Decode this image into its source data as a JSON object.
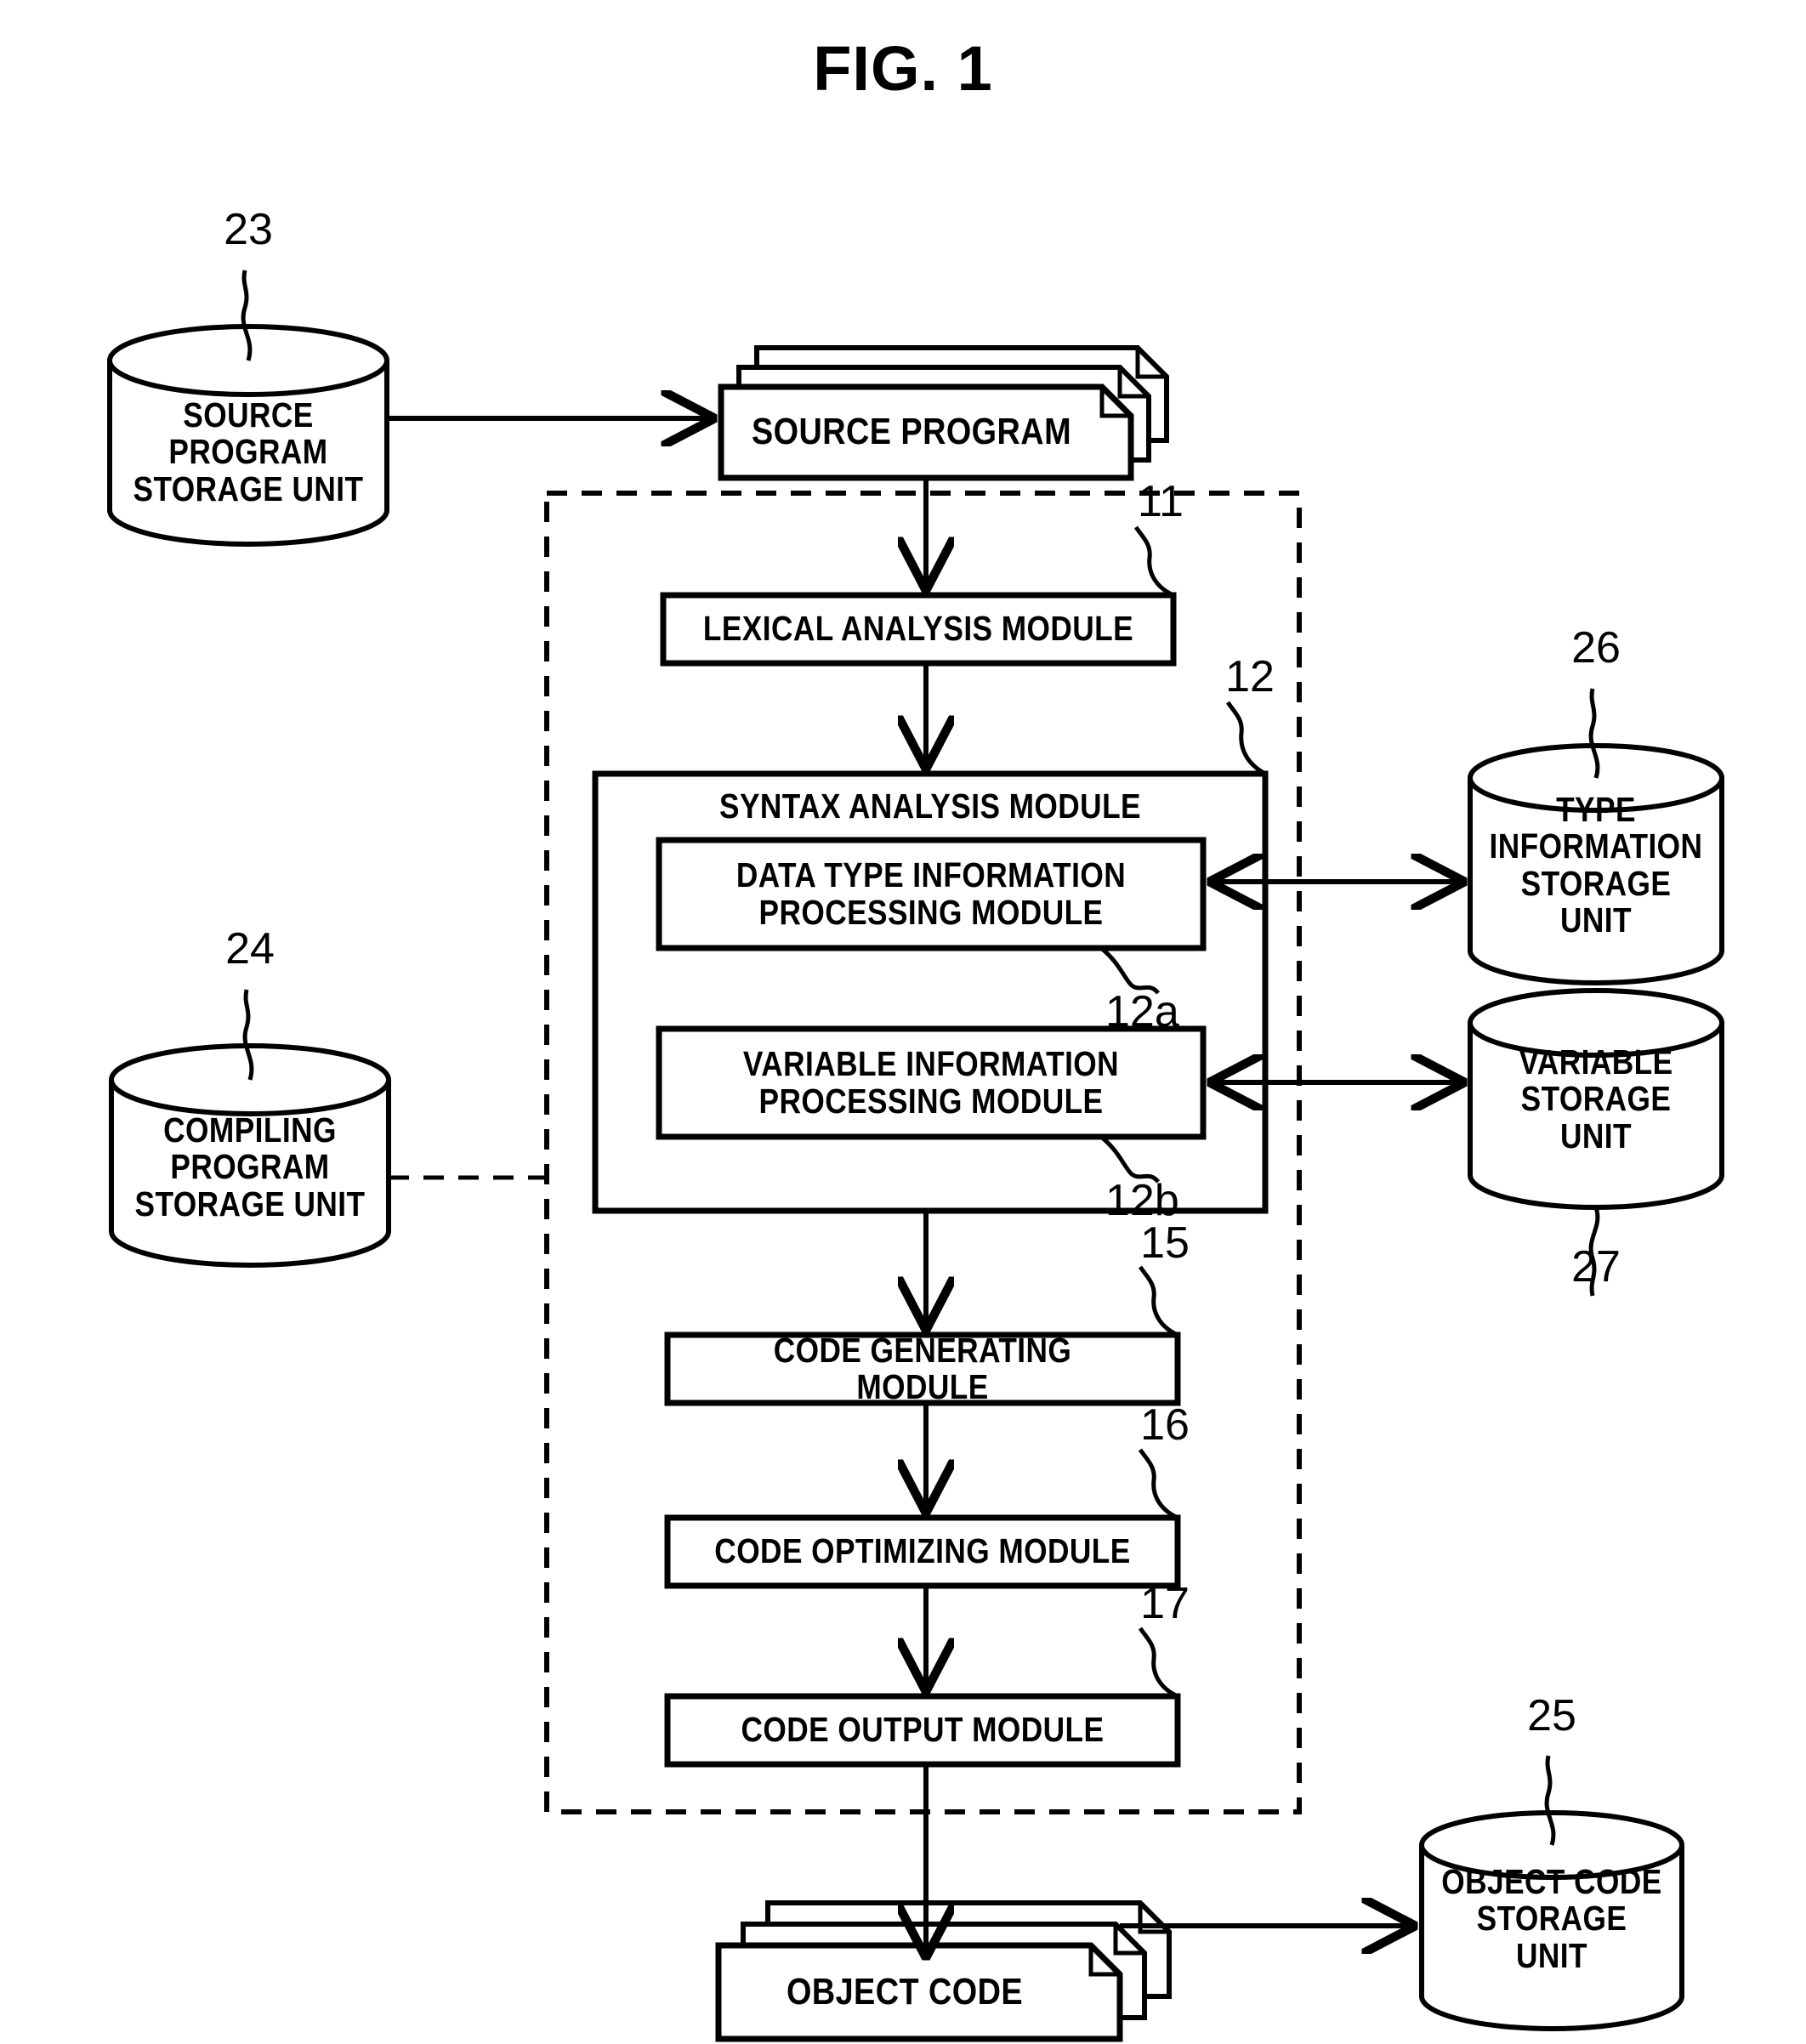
{
  "figure": {
    "title": "FIG. 1",
    "type": "block-diagram",
    "description": "Compiler apparatus block diagram"
  },
  "nodes": {
    "source_program_storage": {
      "label": "SOURCE\nPROGRAM\nSTORAGE UNIT",
      "ref": "23",
      "shape": "cylinder"
    },
    "source_program": {
      "label": "SOURCE PROGRAM",
      "shape": "document-stack"
    },
    "compiling_program_storage": {
      "label": "COMPILING\nPROGRAM\nSTORAGE UNIT",
      "ref": "24",
      "shape": "cylinder"
    },
    "lexical_analysis_module": {
      "label": "LEXICAL ANALYSIS MODULE",
      "ref": "11",
      "shape": "rect"
    },
    "syntax_analysis_module": {
      "label": "SYNTAX ANALYSIS MODULE",
      "ref": "12",
      "shape": "group-rect"
    },
    "data_type_information_processing_module": {
      "label": "DATA TYPE INFORMATION\nPROCESSING MODULE",
      "ref": "12a",
      "shape": "rect"
    },
    "variable_information_processing_module": {
      "label": "VARIABLE INFORMATION\nPROCESSING MODULE",
      "ref": "12b",
      "shape": "rect"
    },
    "type_information_storage": {
      "label": "TYPE\nINFORMATION\nSTORAGE UNIT",
      "ref": "26",
      "shape": "cylinder"
    },
    "variable_storage": {
      "label": "VARIABLE\nSTORAGE UNIT",
      "ref": "27",
      "shape": "cylinder"
    },
    "code_generating_module": {
      "label": "CODE GENERATING MODULE",
      "ref": "15",
      "shape": "rect"
    },
    "code_optimizing_module": {
      "label": "CODE OPTIMIZING MODULE",
      "ref": "16",
      "shape": "rect"
    },
    "code_output_module": {
      "label": "CODE OUTPUT MODULE",
      "ref": "17",
      "shape": "rect"
    },
    "object_code": {
      "label": "OBJECT CODE",
      "shape": "document-stack"
    },
    "object_code_storage": {
      "label": "OBJECT CODE\nSTORAGE UNIT",
      "ref": "25",
      "shape": "cylinder"
    }
  },
  "edges": [
    {
      "from": "source_program_storage",
      "to": "source_program",
      "style": "solid-arrow"
    },
    {
      "from": "source_program",
      "to": "lexical_analysis_module",
      "style": "solid-arrow"
    },
    {
      "from": "lexical_analysis_module",
      "to": "syntax_analysis_module",
      "style": "solid-arrow"
    },
    {
      "from": "syntax_analysis_module",
      "to": "code_generating_module",
      "style": "solid-arrow"
    },
    {
      "from": "code_generating_module",
      "to": "code_optimizing_module",
      "style": "solid-arrow"
    },
    {
      "from": "code_optimizing_module",
      "to": "code_output_module",
      "style": "solid-arrow"
    },
    {
      "from": "code_output_module",
      "to": "object_code",
      "style": "solid-arrow"
    },
    {
      "from": "object_code",
      "to": "object_code_storage",
      "style": "solid-arrow"
    },
    {
      "from": "data_type_information_processing_module",
      "to": "type_information_storage",
      "style": "double-arrow"
    },
    {
      "from": "variable_information_processing_module",
      "to": "variable_storage",
      "style": "double-arrow"
    },
    {
      "from": "compiling_program_storage",
      "to": "compiler_boundary",
      "style": "dashed-line"
    }
  ],
  "compiler_boundary": {
    "style": "dashed-rect"
  },
  "colors": {
    "line": "#000000",
    "background": "#ffffff",
    "text": "#000000"
  }
}
